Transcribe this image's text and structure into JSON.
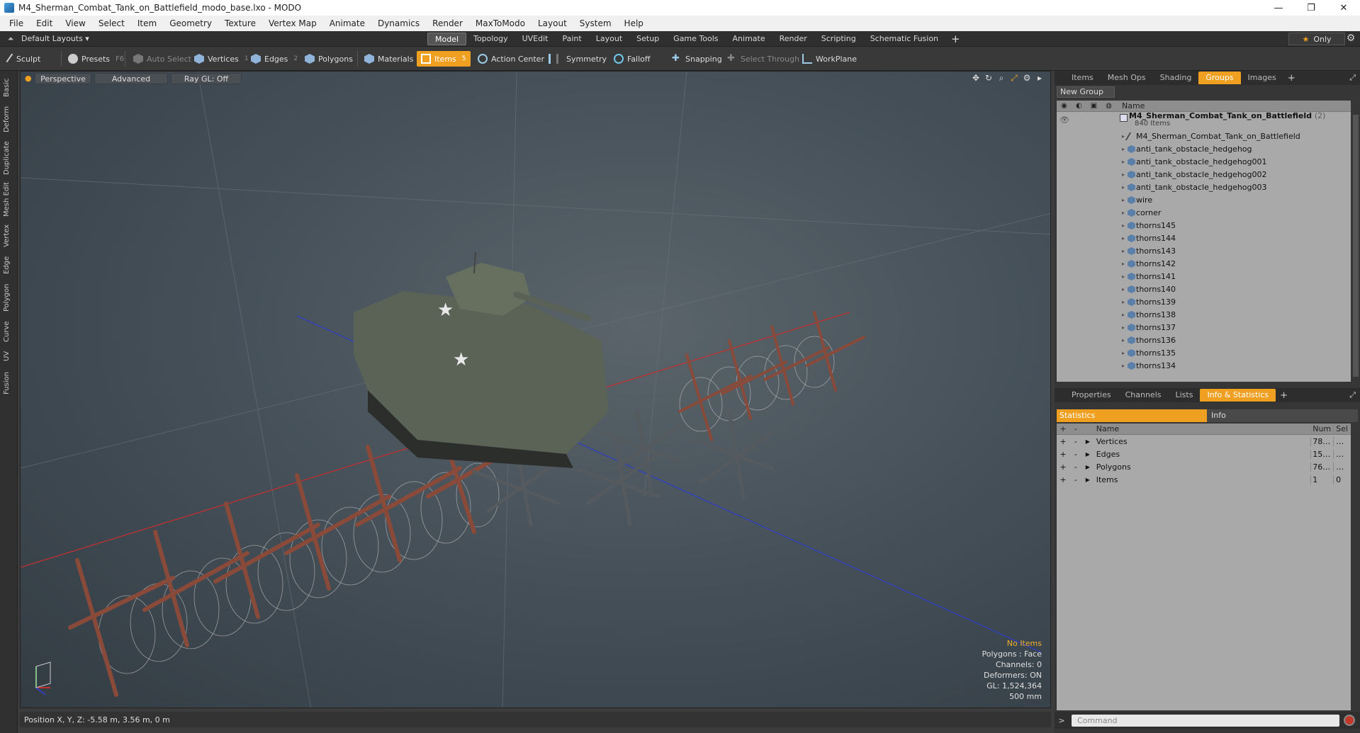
{
  "window": {
    "title": "M4_Sherman_Combat_Tank_on_Battlefield_modo_base.lxo - MODO",
    "minimize": "—",
    "maximize": "❐",
    "close": "✕"
  },
  "menu": [
    "File",
    "Edit",
    "View",
    "Select",
    "Item",
    "Geometry",
    "Texture",
    "Vertex Map",
    "Animate",
    "Dynamics",
    "Render",
    "MaxToModo",
    "Layout",
    "System",
    "Help"
  ],
  "layoutbar": {
    "layouts_label": "Default Layouts ▾",
    "tabs": [
      "Model",
      "Topology",
      "UVEdit",
      "Paint",
      "Layout",
      "Setup",
      "Game Tools",
      "Animate",
      "Render",
      "Scripting",
      "Schematic Fusion"
    ],
    "active_tab": "Model",
    "plus": "+",
    "only_label": "Only"
  },
  "toolbar": {
    "sculpt": "Sculpt",
    "presets": "Presets",
    "presets_key": "F6",
    "auto_select": "Auto Select",
    "vertices": "Vertices",
    "vertices_count": "1",
    "edges": "Edges",
    "edges_count": "2",
    "polygons": "Polygons",
    "materials": "Materials",
    "items": "Items",
    "items_count": "5",
    "action_center": "Action Center",
    "symmetry": "Symmetry",
    "falloff": "Falloff",
    "snapping": "Snapping",
    "select_through": "Select Through",
    "workplane": "WorkPlane"
  },
  "left_tabs": [
    "Basic",
    "Deform",
    "Duplicate",
    "Mesh Edit",
    "Vertex",
    "Edge",
    "Polygon",
    "Curve",
    "UV",
    "Fusion"
  ],
  "viewport": {
    "view_mode": "Perspective",
    "shading": "Advanced",
    "raygl": "Ray GL: Off",
    "info": {
      "no_items": "No Items",
      "polygons": "Polygons : Face",
      "channels": "Channels: 0",
      "deformers": "Deformers: ON",
      "gl": "GL: 1,524,364",
      "scale": "500 mm"
    }
  },
  "status": {
    "position": "Position X, Y, Z:  -5.58 m, 3.56 m, 0 m"
  },
  "right_top": {
    "tabs": [
      "Items",
      "Mesh Ops",
      "Shading",
      "Groups",
      "Images"
    ],
    "active_tab": "Groups",
    "new_group": "New Group",
    "name_header": "Name",
    "group_name": "M4_Sherman_Combat_Tank_on_Battlefield",
    "group_count": "(2)",
    "group_items": "840 Items",
    "items": [
      "M4_Sherman_Combat_Tank_on_Battlefield",
      "anti_tank_obstacle_hedgehog",
      "anti_tank_obstacle_hedgehog001",
      "anti_tank_obstacle_hedgehog002",
      "anti_tank_obstacle_hedgehog003",
      "wire",
      "corner",
      "thorns145",
      "thorns144",
      "thorns143",
      "thorns142",
      "thorns141",
      "thorns140",
      "thorns139",
      "thorns138",
      "thorns137",
      "thorns136",
      "thorns135",
      "thorns134"
    ]
  },
  "right_bottom": {
    "tabs": [
      "Properties",
      "Channels",
      "Lists",
      "Info & Statistics"
    ],
    "active_tab": "Info & Statistics",
    "sub_statistics": "Statistics",
    "sub_info": "Info",
    "headers": {
      "name": "Name",
      "num": "Num",
      "sel": "Sel"
    },
    "rows": [
      {
        "name": "Vertices",
        "num": "78…",
        "sel": "…"
      },
      {
        "name": "Edges",
        "num": "15…",
        "sel": "…"
      },
      {
        "name": "Polygons",
        "num": "76…",
        "sel": "…"
      },
      {
        "name": "Items",
        "num": "1",
        "sel": "0"
      }
    ],
    "command_placeholder": "Command"
  },
  "colors": {
    "accent": "#f0a020",
    "x_axis": "#c03030",
    "z_axis": "#3040c0"
  }
}
